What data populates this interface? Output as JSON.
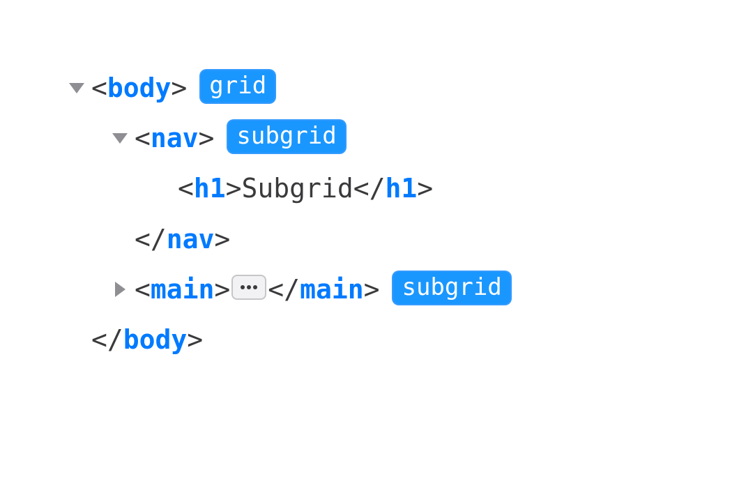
{
  "rows": {
    "body_open": {
      "bracket_open": "<",
      "tag": "body",
      "bracket_close": ">",
      "badge": "grid"
    },
    "nav_open": {
      "bracket_open": "<",
      "tag": "nav",
      "bracket_close": ">",
      "badge": "subgrid"
    },
    "h1": {
      "open_bracket": "<",
      "open_tag": "h1",
      "open_close": ">",
      "text": "Subgrid",
      "close_bracket": "</",
      "close_tag": "h1",
      "close_close": ">"
    },
    "nav_close": {
      "bracket_open": "</",
      "tag": "nav",
      "bracket_close": ">"
    },
    "main": {
      "open_bracket": "<",
      "open_tag": "main",
      "open_close": ">",
      "close_bracket": "</",
      "close_tag": "main",
      "close_close": ">",
      "badge": "subgrid"
    },
    "body_close": {
      "bracket_open": "</",
      "tag": "body",
      "bracket_close": ">"
    }
  }
}
